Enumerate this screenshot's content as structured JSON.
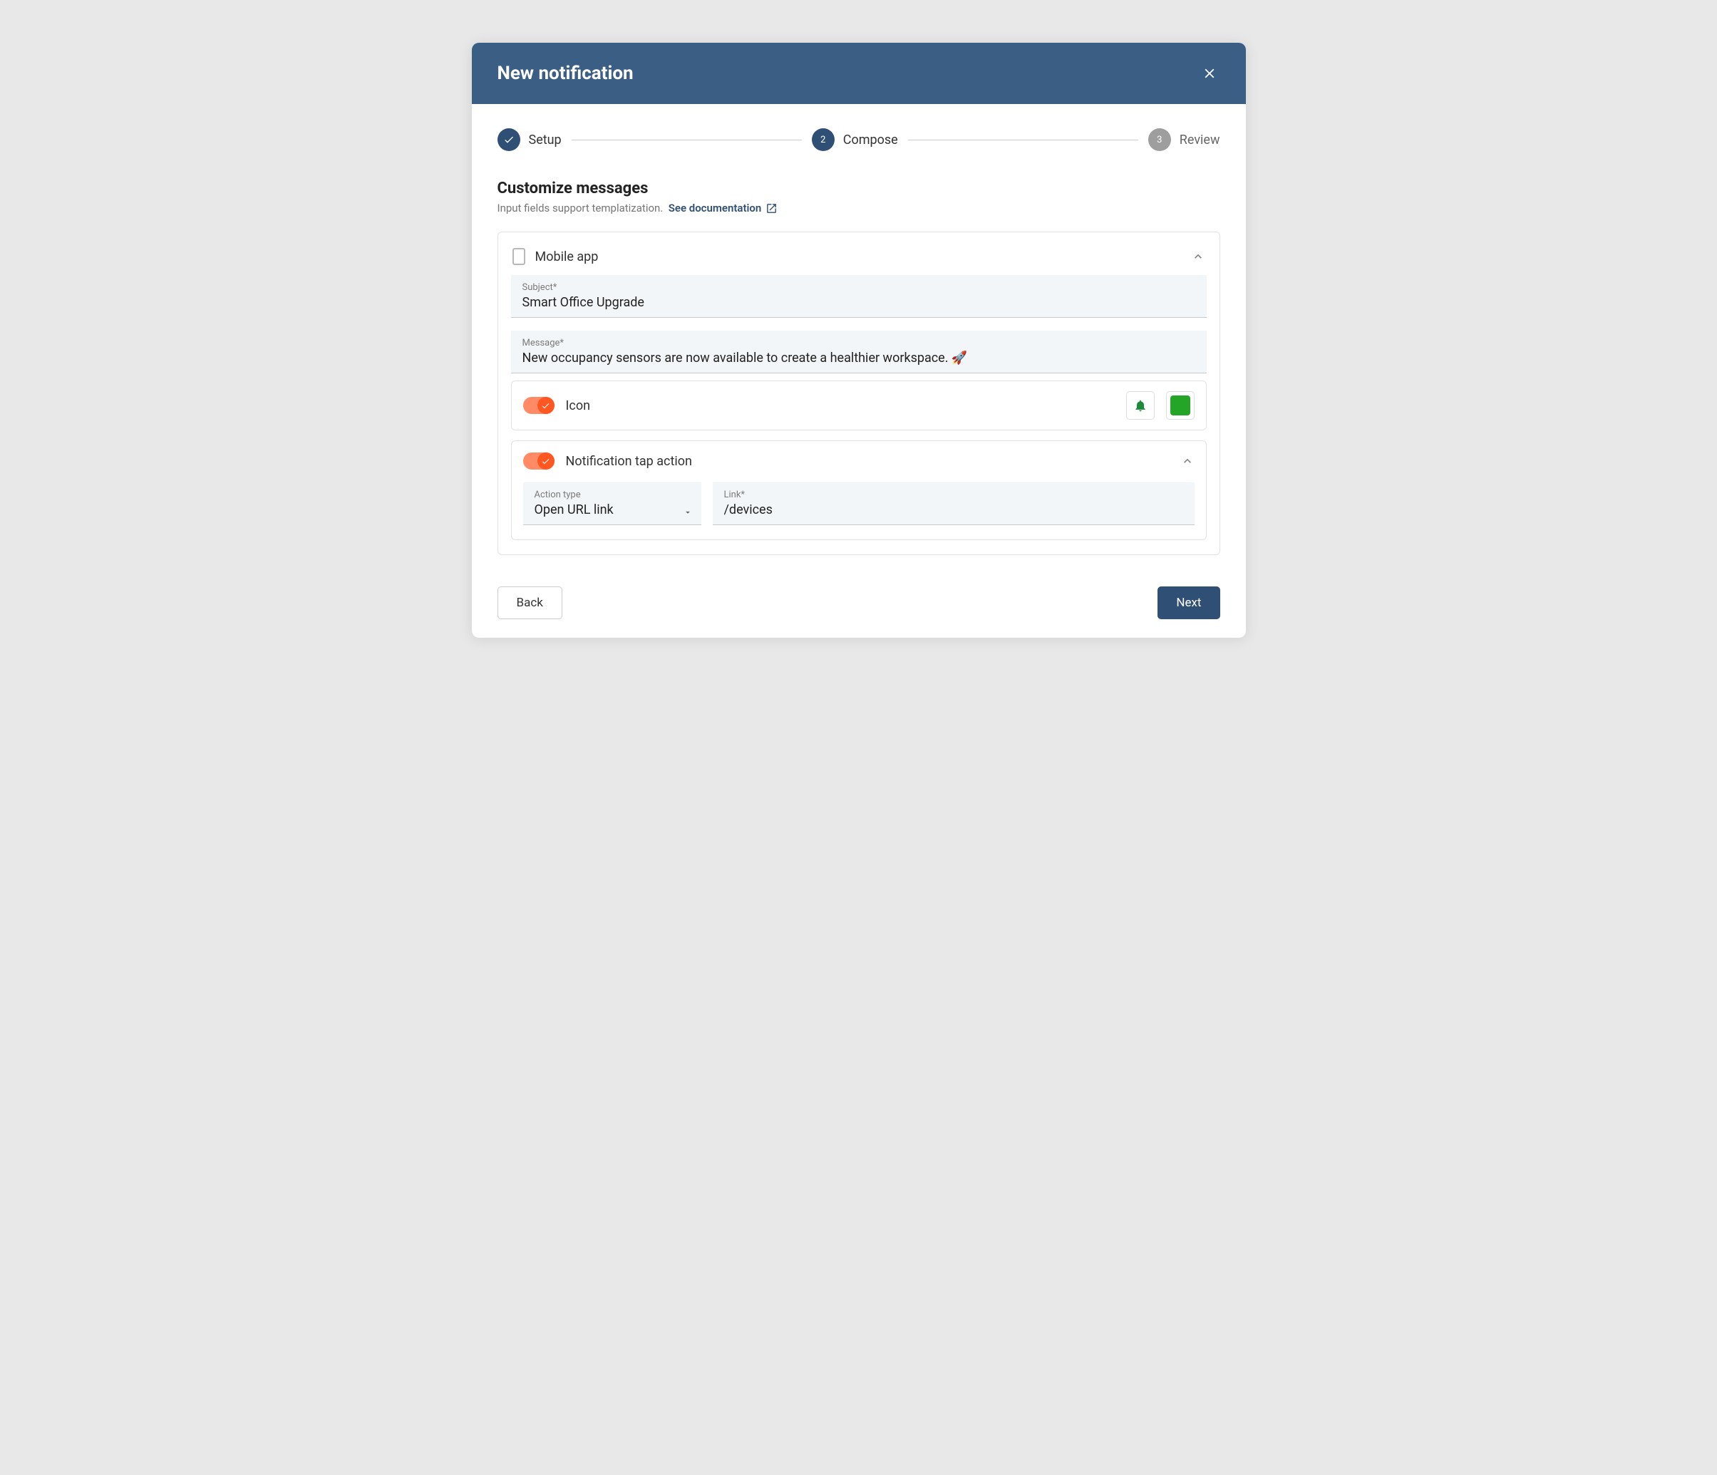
{
  "header": {
    "title": "New notification"
  },
  "stepper": {
    "step1": "Setup",
    "step2_num": "2",
    "step2": "Compose",
    "step3_num": "3",
    "step3": "Review"
  },
  "section": {
    "title": "Customize messages",
    "subtitle": "Input fields support templatization.",
    "doc_link": "See documentation"
  },
  "mobile": {
    "title": "Mobile app",
    "subject_label": "Subject*",
    "subject_value": "Smart Office Upgrade",
    "message_label": "Message*",
    "message_value": "New occupancy sensors are now available to create a healthier workspace. 🚀"
  },
  "icon_row": {
    "label": "Icon",
    "color": "#25a528"
  },
  "tap": {
    "label": "Notification tap action",
    "action_type_label": "Action type",
    "action_type_value": "Open URL link",
    "link_label": "Link*",
    "link_value": "/devices"
  },
  "footer": {
    "back": "Back",
    "next": "Next"
  }
}
